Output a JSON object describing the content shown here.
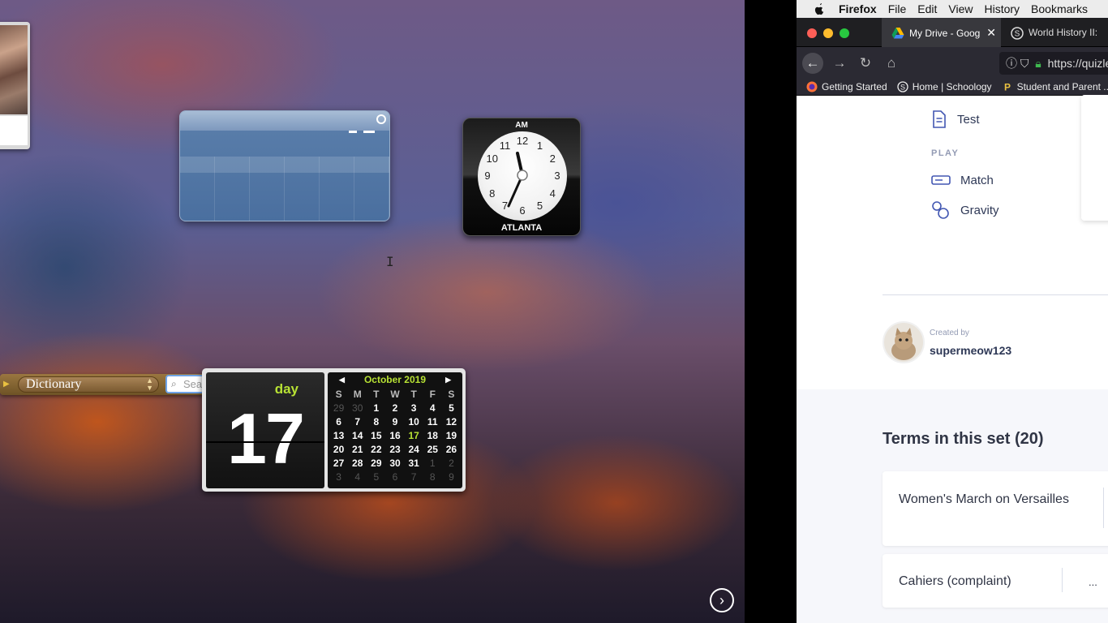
{
  "dashboard": {
    "clock": {
      "ampm": "AM",
      "city": "ATLANTA",
      "numbers": [
        "12",
        "1",
        "2",
        "3",
        "4",
        "5",
        "6",
        "7",
        "8",
        "9",
        "10",
        "11"
      ]
    },
    "dictionary": {
      "source": "Dictionary",
      "search_placeholder": "Search"
    },
    "calendar": {
      "day_name": "day",
      "day_number": "17",
      "month_title": "October 2019",
      "weekdays": [
        "S",
        "M",
        "T",
        "W",
        "T",
        "F",
        "S"
      ],
      "weeks": [
        [
          "29",
          "30",
          "1",
          "2",
          "3",
          "4",
          "5"
        ],
        [
          "6",
          "7",
          "8",
          "9",
          "10",
          "11",
          "12"
        ],
        [
          "13",
          "14",
          "15",
          "16",
          "17",
          "18",
          "19"
        ],
        [
          "20",
          "21",
          "22",
          "23",
          "24",
          "25",
          "26"
        ],
        [
          "27",
          "28",
          "29",
          "30",
          "31",
          "1",
          "2"
        ],
        [
          "3",
          "4",
          "5",
          "6",
          "7",
          "8",
          "9"
        ]
      ]
    }
  },
  "menubar": {
    "app": "Firefox",
    "items": [
      "File",
      "Edit",
      "View",
      "History",
      "Bookmarks"
    ]
  },
  "tabs": [
    {
      "title": "My Drive - Google Drive",
      "active": true
    },
    {
      "title": "World History II: ",
      "active": false
    }
  ],
  "url": "https://quizlet",
  "bookmarks": [
    "Getting Started",
    "Home | Schoology",
    "Student and Parent ..."
  ],
  "page": {
    "study_items": [
      "Test"
    ],
    "play_label": "PLAY",
    "play_items": [
      "Match",
      "Gravity"
    ],
    "created_by_label": "Created by",
    "creator": "supermeow123",
    "terms_title": "Terms in this set (20)",
    "terms": [
      "Women's March on Versailles",
      "Cahiers (complaint)"
    ],
    "term_more": "..."
  },
  "colors": {
    "calendar_accent": "#b8e234",
    "firefox_toolbar": "#2b2a33"
  }
}
